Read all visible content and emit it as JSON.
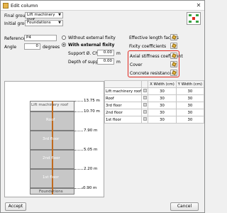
{
  "window": {
    "title": "Edit column"
  },
  "top": {
    "final_group_label": "Final group:",
    "final_group_value": "Lift machinery roof",
    "initial_group_label": "Initial group:",
    "initial_group_value": "Foundations",
    "reference_label": "Reference",
    "reference_value": "P4",
    "angle_label": "Angle",
    "angle_value": "0",
    "angle_unit": "degrees"
  },
  "fixity": {
    "without_label": "Without external fixity",
    "with_label": "With external fixity",
    "selected": "with",
    "support_change_label": "Support Ø. Change",
    "support_change_value": "0.00",
    "support_change_unit": "m",
    "depth_label": "Depth of support",
    "depth_value": "0.00",
    "depth_unit": "m"
  },
  "options": [
    {
      "label": "Effective length factors"
    },
    {
      "label": "Fixity coefficients"
    },
    {
      "label": "Axial stiffness coefficient"
    },
    {
      "label": "Cover"
    },
    {
      "label": "Concrete resistance"
    }
  ],
  "drawing": {
    "levels": [
      {
        "name": "Lift machinery roof",
        "elevation": "13.75 m"
      },
      {
        "name": "Roof",
        "elevation": "10.70 m"
      },
      {
        "name": "3rd floor",
        "elevation": "7.90 m"
      },
      {
        "name": "2nd floor",
        "elevation": "5.05 m"
      },
      {
        "name": "1st floor",
        "elevation": "2.20 m"
      },
      {
        "name": "Foundations",
        "elevation": "-0.90 m"
      }
    ]
  },
  "table": {
    "headers": [
      "",
      "",
      "X Width (cm)",
      "Y Width (cm)"
    ],
    "rows": [
      {
        "name": "Lift machinery roof",
        "x": "30",
        "y": "30"
      },
      {
        "name": "Roof",
        "x": "30",
        "y": "30"
      },
      {
        "name": "3rd floor",
        "x": "30",
        "y": "30"
      },
      {
        "name": "2nd floor",
        "x": "30",
        "y": "30"
      },
      {
        "name": "1st floor",
        "x": "30",
        "y": "30"
      }
    ]
  },
  "buttons": {
    "accept": "Accept",
    "cancel": "Cancel"
  },
  "colors": {
    "highlight": "#e0281f",
    "column": "#c06a1e",
    "storey": "#c7c7c7"
  }
}
